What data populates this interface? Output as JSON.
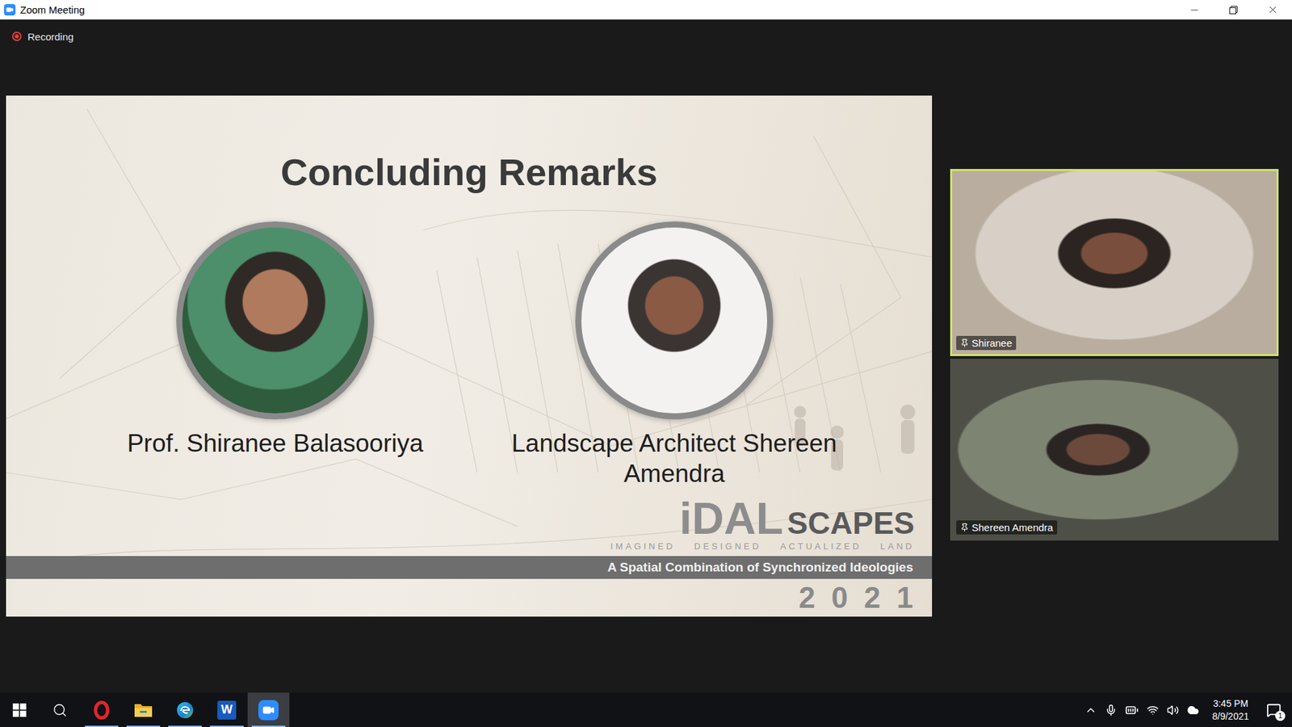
{
  "window": {
    "title": "Zoom Meeting"
  },
  "recording": {
    "label": "Recording",
    "on": true
  },
  "slide": {
    "title": "Concluding Remarks",
    "speakers": [
      {
        "name": "Prof. Shiranee Balasooriya"
      },
      {
        "name": "Landscape Architect Shereen Amendra"
      }
    ],
    "logo": {
      "mark": "iDAL",
      "word": "SCAPES",
      "acronym": [
        "IMAGINED",
        "DESIGNED",
        "ACTUALIZED",
        "LAND"
      ],
      "tagline": "A Spatial Combination of Synchronized Ideologies",
      "year": [
        "2",
        "0",
        "2",
        "1"
      ]
    }
  },
  "participants": [
    {
      "name": "Shiranee",
      "speaking": true
    },
    {
      "name": "Shereen Amendra",
      "speaking": false
    }
  ],
  "taskbar": {
    "apps": [
      {
        "kind": "opera",
        "running": true,
        "active": false
      },
      {
        "kind": "explorer",
        "running": true,
        "active": false
      },
      {
        "kind": "edge",
        "running": true,
        "active": false
      },
      {
        "kind": "word",
        "glyph": "W",
        "running": true,
        "active": false
      },
      {
        "kind": "zoom",
        "running": true,
        "active": true
      }
    ],
    "time": "3:45 PM",
    "date": "8/9/2021",
    "notifications": "1"
  }
}
